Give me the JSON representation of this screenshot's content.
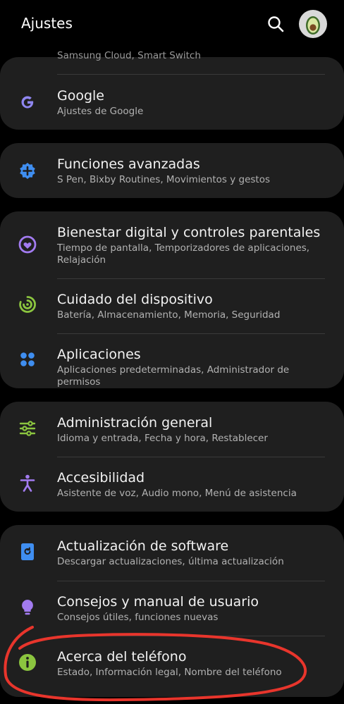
{
  "header": {
    "title": "Ajustes"
  },
  "partial_item": {
    "subtitle": "Samsung Cloud, Smart Switch"
  },
  "items": [
    {
      "label": "Google",
      "subtitle": "Ajustes de Google",
      "icon": "google-icon"
    },
    {
      "label": "Funciones avanzadas",
      "subtitle": "S Pen, Bixby Routines, Movimientos y gestos",
      "icon": "advanced-features-icon"
    },
    {
      "label": "Bienestar digital y controles parentales",
      "subtitle": "Tiempo de pantalla, Temporizadores de aplicaciones, Relajación",
      "icon": "digital-wellbeing-icon"
    },
    {
      "label": "Cuidado del dispositivo",
      "subtitle": "Batería, Almacenamiento, Memoria, Seguridad",
      "icon": "device-care-icon"
    },
    {
      "label": "Aplicaciones",
      "subtitle": "Aplicaciones predeterminadas, Administrador de permisos",
      "icon": "apps-icon"
    },
    {
      "label": "Administración general",
      "subtitle": "Idioma y entrada, Fecha y hora, Restablecer",
      "icon": "general-management-icon"
    },
    {
      "label": "Accesibilidad",
      "subtitle": "Asistente de voz, Audio mono, Menú de asistencia",
      "icon": "accessibility-icon"
    },
    {
      "label": "Actualización de software",
      "subtitle": "Descargar actualizaciones, última actualización",
      "icon": "software-update-icon"
    },
    {
      "label": "Consejos y manual de usuario",
      "subtitle": "Consejos útiles, funciones nuevas",
      "icon": "tips-icon"
    },
    {
      "label": "Acerca del teléfono",
      "subtitle": "Estado, Información legal, Nombre del teléfono",
      "icon": "info-icon"
    }
  ],
  "colors": {
    "background": "#000000",
    "card": "#1f1f1f",
    "annotation": "#e8352c"
  }
}
